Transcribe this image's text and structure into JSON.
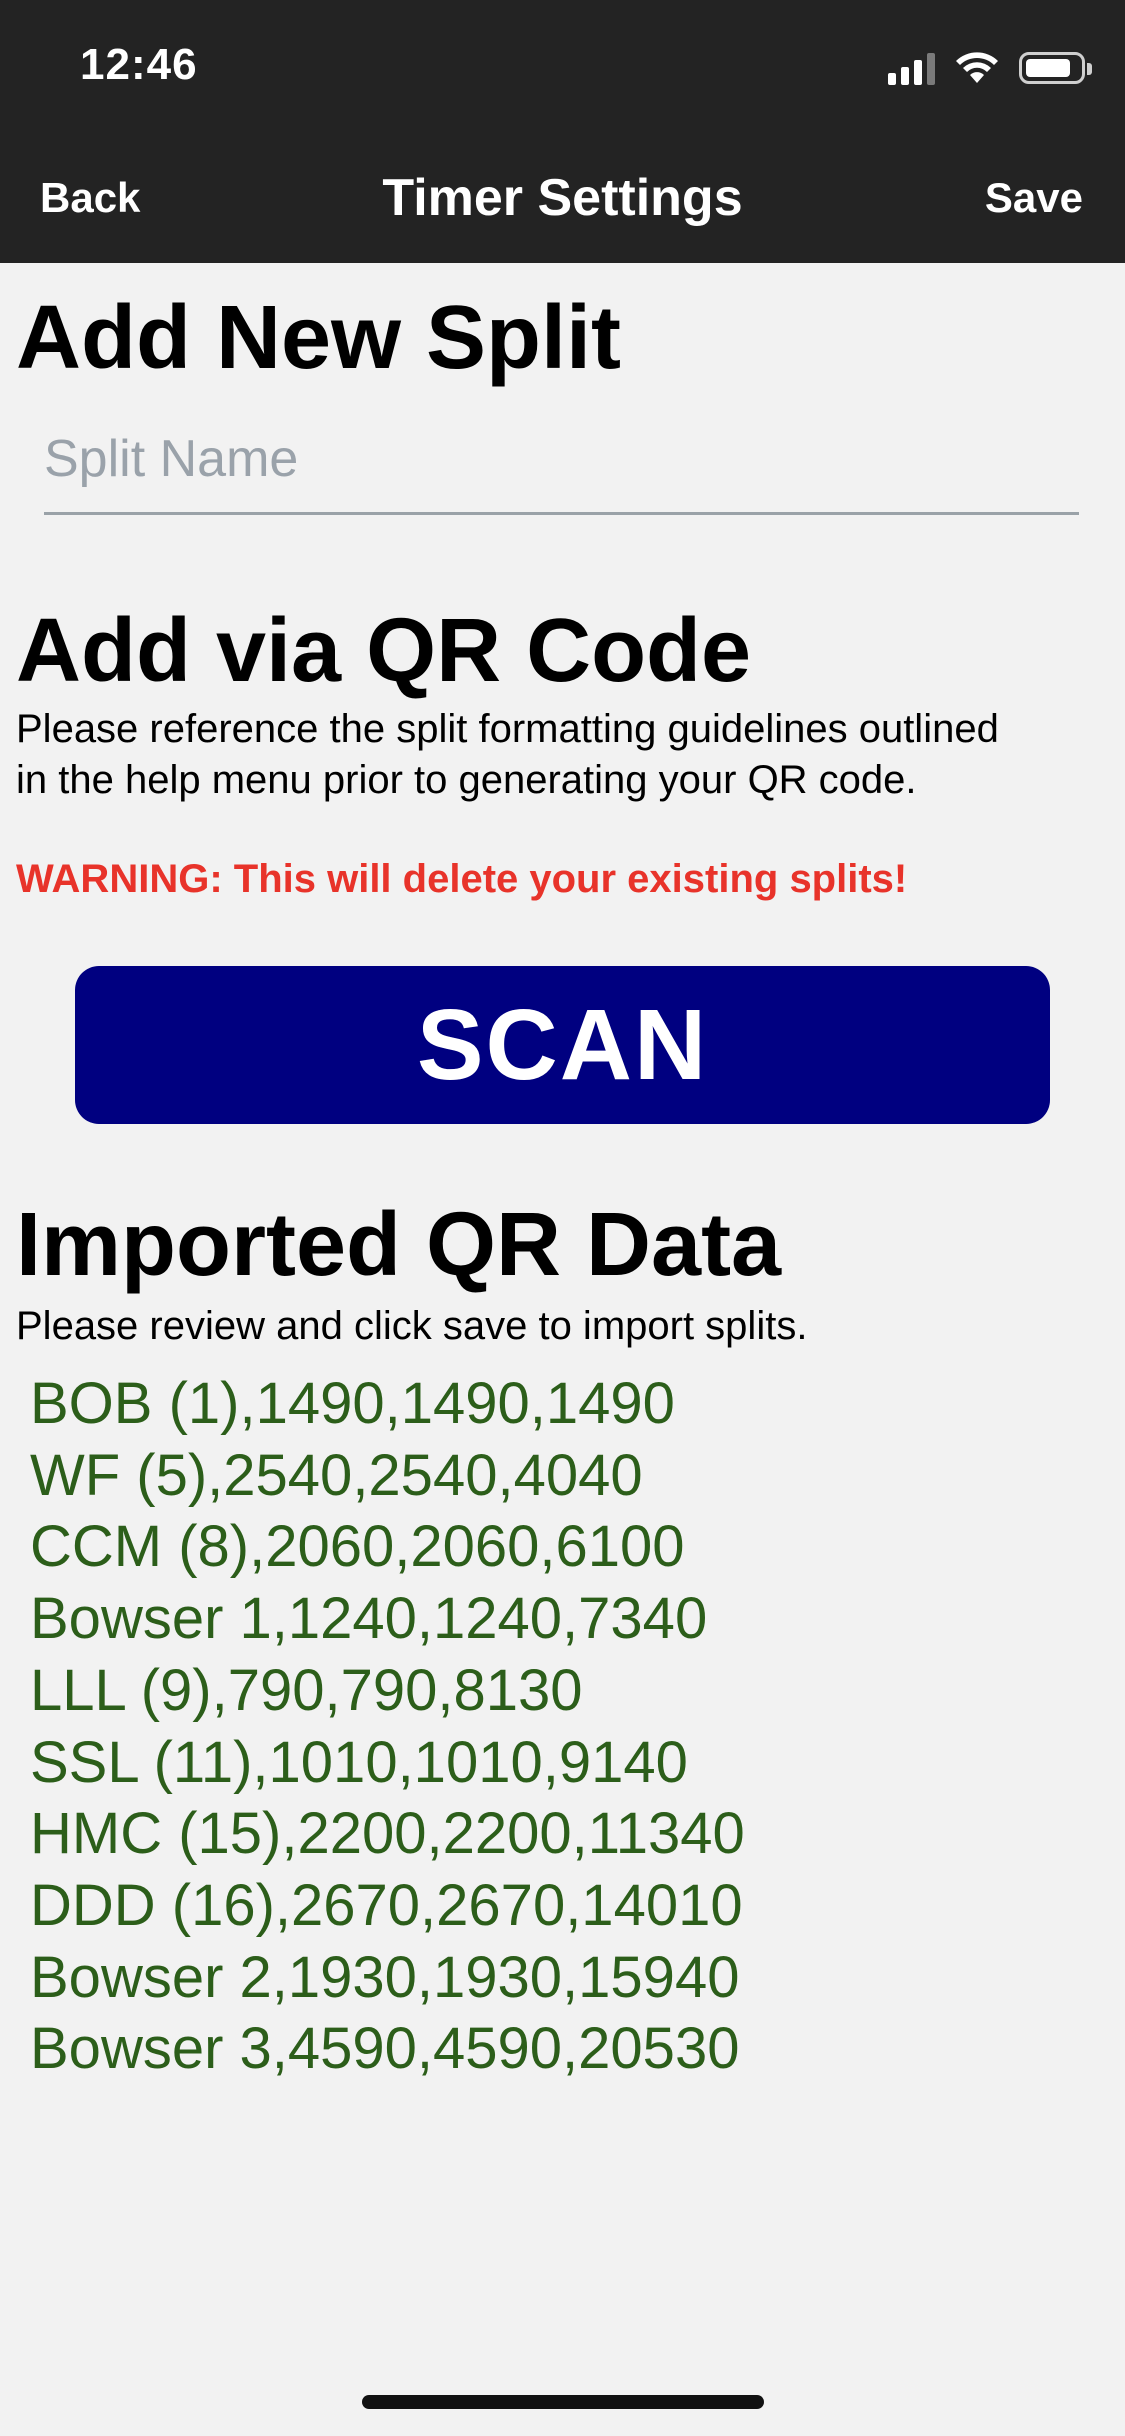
{
  "status_bar": {
    "time": "12:46",
    "icons": [
      "cellular-signal-icon",
      "wifi-icon",
      "battery-icon"
    ]
  },
  "nav": {
    "back_label": "Back",
    "title": "Timer Settings",
    "save_label": "Save"
  },
  "add_split": {
    "heading": "Add New Split",
    "input_placeholder": "Split Name",
    "input_value": ""
  },
  "qr_section": {
    "heading": "Add via QR Code",
    "description_line1": "Please reference the split formatting guidelines outlined",
    "description_line2": "in the help menu prior to generating your QR code.",
    "warning": "WARNING: This will delete your existing splits!",
    "scan_label": "SCAN"
  },
  "imported": {
    "heading": "Imported QR Data",
    "description": "Please review and click save to import splits.",
    "rows": [
      "BOB (1),1490,1490,1490",
      "WF (5),2540,2540,4040",
      "CCM (8),2060,2060,6100",
      "Bowser 1,1240,1240,7340",
      "LLL (9),790,790,8130",
      "SSL (11),1010,1010,9140",
      "HMC (15),2200,2200,11340",
      "DDD (16),2670,2670,14010",
      "Bowser 2,1930,1930,15940",
      "Bowser 3,4590,4590,20530"
    ]
  },
  "colors": {
    "header_bg": "#232323",
    "page_bg": "#f2f2f2",
    "scan_button": "#000080",
    "warning": "#e8332a",
    "imported_text": "#2c5e1a"
  }
}
